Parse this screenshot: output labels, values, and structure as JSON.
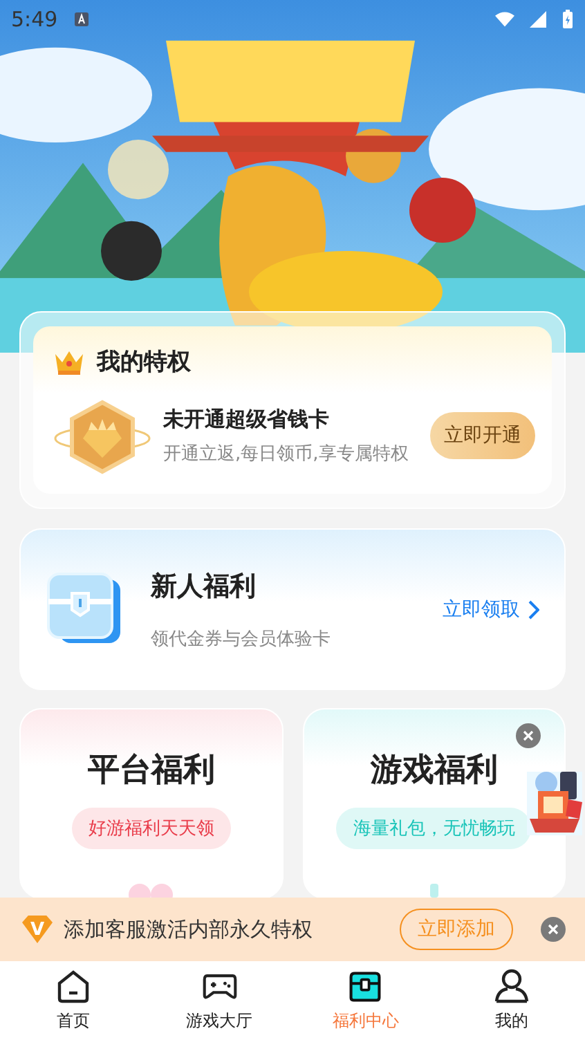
{
  "status_bar": {
    "time": "5:49"
  },
  "privilege": {
    "title": "我的特权",
    "card_title": "未开通超级省钱卡",
    "card_desc": "开通立返,每日领币,享专属特权",
    "button": "立即开通"
  },
  "newbie": {
    "title": "新人福利",
    "desc": "领代金券与会员体验卡",
    "link": "立即领取"
  },
  "welfare_cards": [
    {
      "kind": "platform",
      "title": "平台福利",
      "tag": "好游福利天天领",
      "closable": false
    },
    {
      "kind": "game",
      "title": "游戏福利",
      "tag": "海量礼包，无忧畅玩",
      "closable": true
    }
  ],
  "notice": {
    "badge": "V",
    "text": "添加客服激活内部永久特权",
    "button": "立即添加"
  },
  "nav": [
    {
      "kind": "home",
      "label": "首页",
      "selected": false
    },
    {
      "kind": "gamepad",
      "label": "游戏大厅",
      "selected": false
    },
    {
      "kind": "chest",
      "label": "福利中心",
      "selected": true
    },
    {
      "kind": "person",
      "label": "我的",
      "selected": false
    }
  ]
}
